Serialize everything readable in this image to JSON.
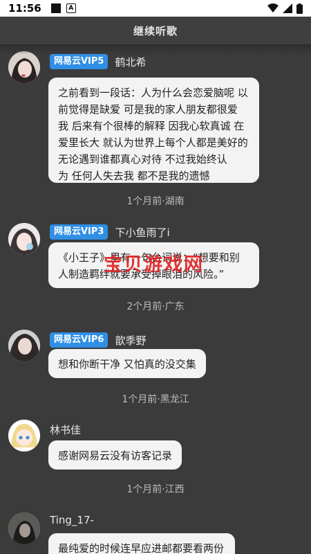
{
  "status_bar": {
    "time": "11:56",
    "a_icon": "A"
  },
  "header": {
    "title": "继续听歌"
  },
  "watermark": "宝贝游戏网",
  "comments": [
    {
      "vip": "网易云VIP5",
      "user": "鹤北希",
      "lines": [
        "之前看到一段话：人为什么会恋爱脑呢 以",
        "前觉得是缺爱 可是我的家人朋友都很爱",
        "我 后来有个很棒的解释 因我心软真诚 在",
        "爱里长大 就认为世界上每个人都是美好的",
        "无论遇到谁都真心对待 不过我始终认",
        "为 任何人失去我 都不是我的遗憾"
      ],
      "meta": "1个月前·湖南"
    },
    {
      "vip": "网易云VIP3",
      "user": "下小鱼雨了i",
      "lines": [
        "《小王子》里有一句台词说：“想要和别",
        "人制造羁绊就要承受掉眼泪的风险。”"
      ],
      "meta": "2个月前·广东"
    },
    {
      "vip": "网易云VIP6",
      "user": "歆季野",
      "lines": [
        "想和你断干净 又怕真的没交集"
      ],
      "meta": "1个月前·黑龙江"
    },
    {
      "vip": "",
      "user": "林书佳",
      "lines": [
        "感谢网易云没有访客记录"
      ],
      "meta": "1个月前·江西"
    },
    {
      "vip": "",
      "user": "Ting_17-",
      "lines": [
        "最纯爱的时候连早应进邮都要看两份"
      ],
      "meta": ""
    }
  ]
}
